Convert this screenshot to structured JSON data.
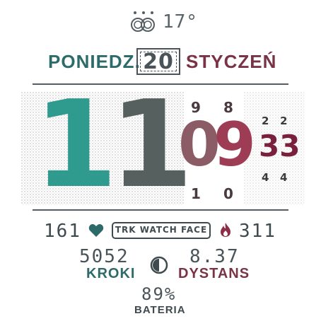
{
  "weather": {
    "icon": "cloud-snow-icon",
    "temperature": "17°"
  },
  "date": {
    "day_name": "PONIEDZ.",
    "day_number": "20",
    "month_name": "STYCZEŃ"
  },
  "time": {
    "hour_digit_1": "1",
    "hour_digit_2": "1",
    "minute_digits_1": "0",
    "minute_digits_2": "9",
    "minute_prev_1": "9",
    "minute_prev_2": "8",
    "minute_next_1": "1",
    "minute_next_2": "0",
    "seconds": "33",
    "seconds_prev_1": "2",
    "seconds_prev_2": "2",
    "seconds_next_1": "4",
    "seconds_next_2": "4"
  },
  "stats": {
    "heart_rate": "161",
    "heart_icon": "heart-icon",
    "brand": "TRK WATCH FACE",
    "calories_icon": "flame-icon",
    "calories": "311",
    "steps_value": "5052",
    "steps_label": "KROKI",
    "distance_icon": "contrast-icon",
    "distance_value": "8.37",
    "distance_label": "DYSTANS",
    "battery_value": "89%",
    "battery_label": "BATERIA"
  },
  "colors": {
    "teal": "#2f9a8e",
    "slate": "#56605f",
    "mauve": "#8c5c66",
    "wine": "#9d3c54",
    "deep_wine": "#7a1f3c"
  }
}
